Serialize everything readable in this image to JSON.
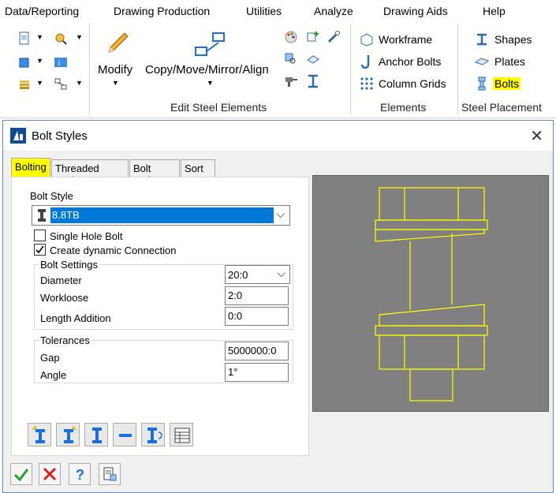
{
  "menu": {
    "items": [
      "Data/Reporting",
      "Drawing Production",
      "Utilities",
      "Analyze",
      "Drawing Aids",
      "Help"
    ]
  },
  "ribbon": {
    "modify_label": "Modify",
    "copy_label": "Copy/Move/Mirror/Align",
    "edit_group": "Edit Steel Elements",
    "elements": {
      "workframe": "Workframe",
      "anchor_bolts": "Anchor Bolts",
      "column_grids": "Column Grids",
      "group": "Elements"
    },
    "placement": {
      "shapes": "Shapes",
      "plates": "Plates",
      "bolts": "Bolts",
      "group": "Steel Placement"
    }
  },
  "dialog": {
    "title": "Bolt Styles",
    "tabs": [
      "Bolting",
      "Threaded Rods",
      "Bolt Style",
      "Sort"
    ],
    "bolt_style_label": "Bolt Style",
    "bolt_style_value": "8.8TB",
    "single_hole_label": "Single Hole Bolt",
    "single_hole_checked": false,
    "dynamic_label": "Create dynamic Connection",
    "dynamic_checked": true,
    "settings": {
      "title": "Bolt Settings",
      "diameter_label": "Diameter",
      "diameter_value": "20:0",
      "workloose_label": "Workloose",
      "workloose_value": "2:0",
      "length_label": "Length Addition",
      "length_value": "0:0"
    },
    "tolerances": {
      "title": "Tolerances",
      "gap_label": "Gap",
      "gap_value": "5000000:0",
      "angle_label": "Angle",
      "angle_value": "1°"
    }
  },
  "colors": {
    "highlight": "#ffff00",
    "selection": "#0078d7",
    "preview_bg": "#808080",
    "drawing": "#ffff00"
  }
}
